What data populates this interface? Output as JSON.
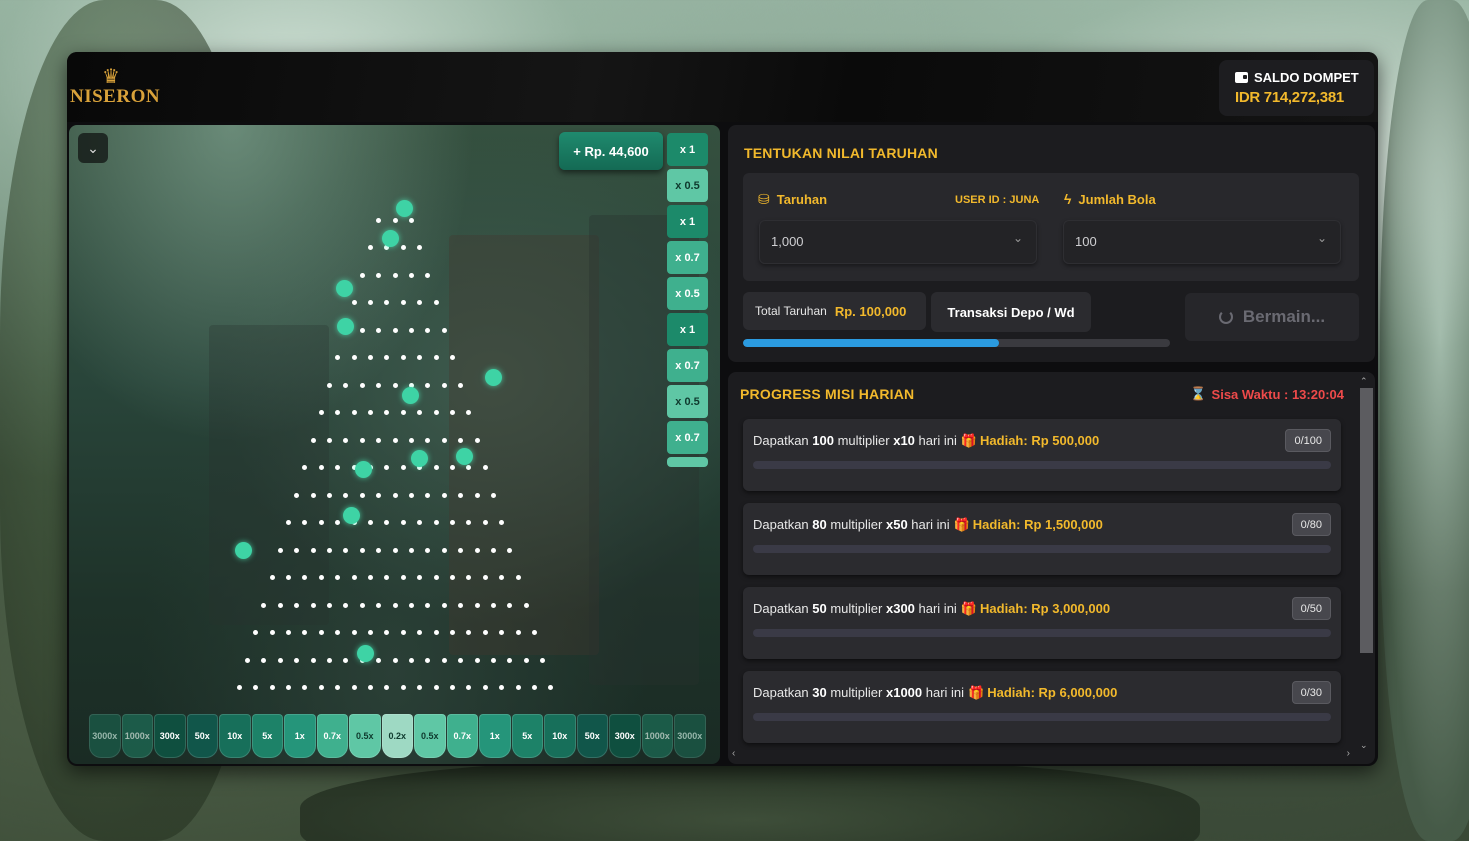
{
  "brand": {
    "name": "NISERON",
    "icon": "crown-icon"
  },
  "wallet": {
    "title": "SALDO DOMPET",
    "amount": "IDR 714,272,381",
    "icon": "wallet-icon"
  },
  "game": {
    "win_pill": "+ Rp. 44,600",
    "toggle_icon": "chevron-down-icon",
    "history": [
      "x 1",
      "x 0.5",
      "x 1",
      "x 0.7",
      "x 0.5",
      "x 1",
      "x 0.7",
      "x 0.5",
      "x 0.7"
    ],
    "buckets": [
      "3000x",
      "1000x",
      "300x",
      "50x",
      "10x",
      "5x",
      "1x",
      "0.7x",
      "0.5x",
      "0.2x",
      "0.5x",
      "0.7x",
      "1x",
      "5x",
      "10x",
      "50x",
      "300x",
      "1000x",
      "3000x"
    ],
    "balls_in_play": 13
  },
  "bet": {
    "title": "TENTUKAN NILAI TARUHAN",
    "taruhan_label": "Taruhan",
    "user_id": "USER ID : JUNA",
    "jumlah_bola_label": "Jumlah Bola",
    "taruhan_value": "1,000",
    "jumlah_bola_value": "100",
    "total_label": "Total Taruhan",
    "total_value": "Rp. 100,000",
    "depo_button": "Transaksi Depo / Wd",
    "play_button": "Bermain...",
    "progress": 0.6
  },
  "missions": {
    "title": "PROGRESS MISI HARIAN",
    "timer": "Sisa Waktu : 13:20:04",
    "items": [
      {
        "prefix": "Dapatkan ",
        "count": "100",
        "mid": " multiplier ",
        "mult": "x10",
        "suffix": " hari ini",
        "reward": "Hadiah: Rp 500,000",
        "progress": "0/100"
      },
      {
        "prefix": "Dapatkan ",
        "count": "80",
        "mid": " multiplier ",
        "mult": "x50",
        "suffix": " hari ini",
        "reward": "Hadiah: Rp 1,500,000",
        "progress": "0/80"
      },
      {
        "prefix": "Dapatkan ",
        "count": "50",
        "mid": " multiplier ",
        "mult": "x300",
        "suffix": " hari ini",
        "reward": "Hadiah: Rp 3,000,000",
        "progress": "0/50"
      },
      {
        "prefix": "Dapatkan ",
        "count": "30",
        "mid": " multiplier ",
        "mult": "x1000",
        "suffix": " hari ini",
        "reward": "Hadiah: Rp 6,000,000",
        "progress": "0/30"
      }
    ]
  },
  "colors": {
    "accent": "#f2b92c",
    "teal": "#1c8a6a",
    "progress": "#2b9be0",
    "timer": "#ee4a4a"
  }
}
